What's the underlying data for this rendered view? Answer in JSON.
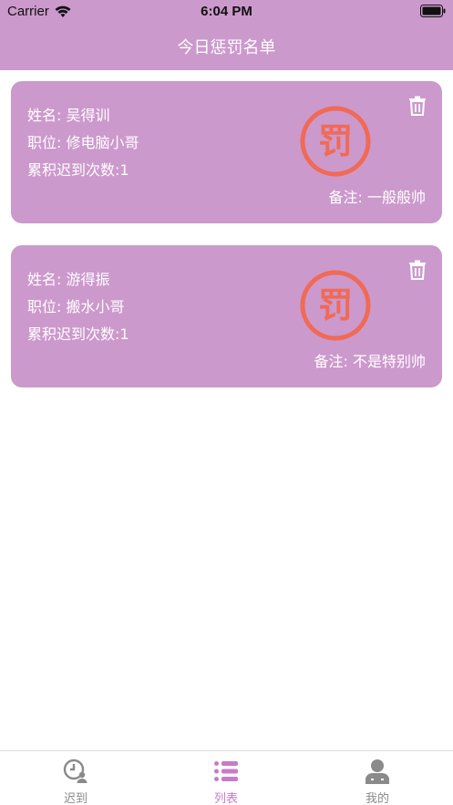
{
  "status_bar": {
    "carrier": "Carrier",
    "time": "6:04 PM"
  },
  "header": {
    "title": "今日惩罚名单"
  },
  "cards": [
    {
      "name": "姓名: 吴得训",
      "position": "职位: 修电脑小哥",
      "late_count": "累积迟到次数:1",
      "remark": "备注: 一般般帅",
      "stamp": "罚"
    },
    {
      "name": "姓名: 游得振",
      "position": "职位: 搬水小哥",
      "late_count": "累积迟到次数:1",
      "remark": "备注: 不是特别帅",
      "stamp": "罚"
    }
  ],
  "tabbar": {
    "items": [
      {
        "label": "迟到",
        "icon": "clock-user-icon",
        "active": false
      },
      {
        "label": "列表",
        "icon": "list-icon",
        "active": true
      },
      {
        "label": "我的",
        "icon": "person-icon",
        "active": false
      }
    ]
  },
  "colors": {
    "brand": "#cc99cc",
    "stamp": "#f06a55",
    "tab_active": "#c97ac9",
    "tab_inactive": "#8a8a8a"
  }
}
